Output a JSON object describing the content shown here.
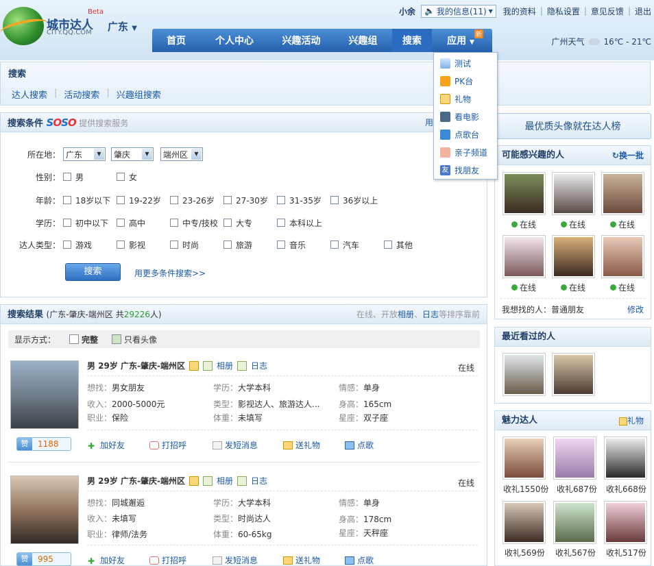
{
  "brand": {
    "name": "城市达人",
    "domain": "CITY.QQ.COM",
    "beta": "Beta",
    "city": "广东"
  },
  "topbar": {
    "user": "小余",
    "my_info": "我的信息(11)",
    "links": [
      "我的资料",
      "隐私设置",
      "意见反馈",
      "退出"
    ]
  },
  "nav": {
    "items": [
      "首页",
      "个人中心",
      "兴趣活动",
      "兴趣组",
      "搜索",
      "应用"
    ],
    "new_badge": "新"
  },
  "weather": {
    "city": "广州天气",
    "temp": "16℃ - 21℃"
  },
  "apps_menu": [
    "测试",
    "PK台",
    "礼物",
    "看电影",
    "点歌台",
    "亲子频道",
    "找朋友"
  ],
  "search": {
    "title": "搜索",
    "tabs": [
      "达人搜索",
      "活动搜索",
      "兴趣组搜索"
    ]
  },
  "conditions": {
    "title": "搜索条件",
    "provider": "SOSO",
    "provider_hint": "提供搜索服务",
    "right_cut": "用",
    "location_label": "所在地：",
    "province": "广东",
    "city": "肇庆",
    "district": "端州区",
    "gender_label": "性别：",
    "gender": [
      "男",
      "女"
    ],
    "age_label": "年龄：",
    "ages": [
      "18岁以下",
      "19-22岁",
      "23-26岁",
      "27-30岁",
      "31-35岁",
      "36岁以上"
    ],
    "edu_label": "学历：",
    "edus": [
      "初中以下",
      "高中",
      "中专/技校",
      "大专",
      "本科以上"
    ],
    "type_label": "达人类型：",
    "types": [
      "游戏",
      "影视",
      "时尚",
      "旅游",
      "音乐",
      "汽车",
      "其他"
    ],
    "search_btn": "搜索",
    "more_link": "用更多条件搜索>>"
  },
  "results": {
    "title": "搜索结果",
    "scope_pre": "(广东-肇庆-端州区  共",
    "count": "29226",
    "scope_post": "人)",
    "sort_pre": "在线、开放",
    "sort_a": "相册",
    "sort_mid": "、",
    "sort_b": "日志",
    "sort_post": "等排序靠前",
    "display_label": "显示方式：",
    "display_full": "完整",
    "display_avatar": "只看头像",
    "records": [
      {
        "head": "男  29岁  广东-肇庆-端州区",
        "album": "相册",
        "diary": "日志",
        "status": "在线",
        "f": [
          [
            "想找：",
            "男女朋友"
          ],
          [
            "学历：",
            "大学本科"
          ],
          [
            "情感：",
            "单身"
          ],
          [
            "收入：",
            "2000-5000元"
          ],
          [
            "类型：",
            "影视达人、旅游达人..."
          ],
          [
            "身高：",
            "165cm"
          ],
          [
            "职业：",
            "保险"
          ],
          [
            "体重：",
            "未填写"
          ],
          [
            "星座：",
            "双子座"
          ]
        ],
        "zan_label": "赞",
        "zan": "1188"
      },
      {
        "head": "男  29岁  广东-肇庆-端州区",
        "album": "相册",
        "diary": "日志",
        "status": "在线",
        "f": [
          [
            "想找：",
            "同城邂逅"
          ],
          [
            "学历：",
            "大学本科"
          ],
          [
            "情感：",
            "单身"
          ],
          [
            "收入：",
            "未填写"
          ],
          [
            "类型：",
            "时尚达人"
          ],
          [
            "身高：",
            "178cm"
          ],
          [
            "职业：",
            "律师/法务"
          ],
          [
            "体重：",
            "60-65kg"
          ],
          [
            "星座：",
            "天秤座"
          ]
        ],
        "zan_label": "赞",
        "zan": "995"
      }
    ],
    "actions": [
      "加好友",
      "打招呼",
      "发短消息",
      "送礼物",
      "点歌"
    ]
  },
  "right": {
    "banner": "最优质头像就在达人榜",
    "interest_title": "可能感兴趣的人",
    "refresh": "换一批",
    "online": "在线",
    "looking_label": "我想找的人：",
    "looking_value": "普通朋友",
    "edit": "修改",
    "recent_title": "最近看过的人",
    "charm_title": "魅力达人",
    "gift": "礼物",
    "charm": [
      "收礼1550份",
      "收礼687份",
      "收礼668份",
      "收礼569份",
      "收礼567份",
      "收礼517份"
    ]
  },
  "colors": {
    "nav_blue": "#2560ad",
    "link": "#1a5aa8",
    "orange": "#f08a24"
  }
}
